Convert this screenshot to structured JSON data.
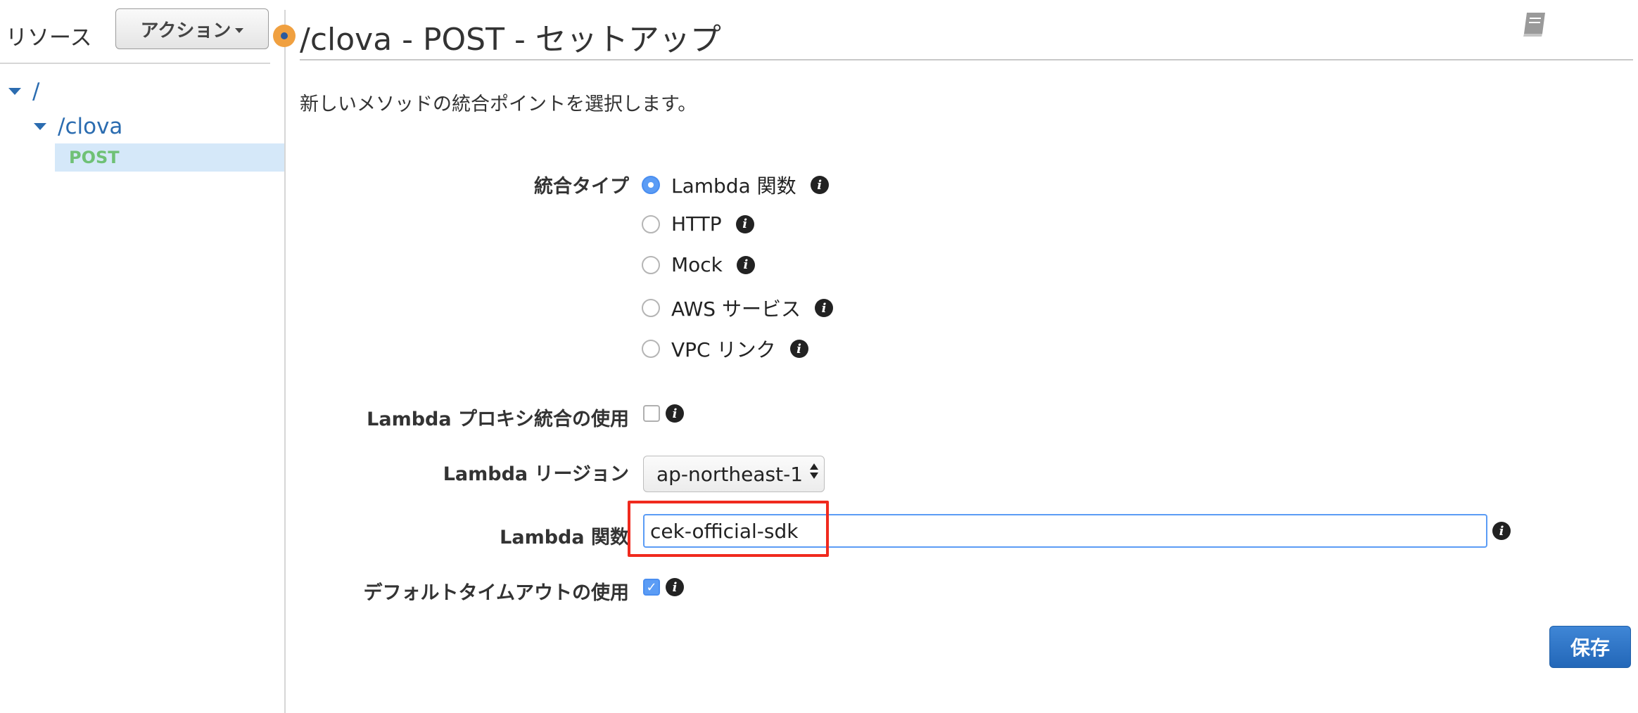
{
  "sidebar": {
    "title": "リソース",
    "actions_label": "アクション",
    "tree": {
      "root": "/",
      "clova": "/clova",
      "post": "POST"
    }
  },
  "header": {
    "title": "/clova - POST - セットアップ",
    "subtitle": "新しいメソッドの統合ポイントを選択します。"
  },
  "form": {
    "integration_type_label": "統合タイプ",
    "integration_options": [
      {
        "label": "Lambda 関数",
        "selected": true
      },
      {
        "label": "HTTP",
        "selected": false
      },
      {
        "label": "Mock",
        "selected": false
      },
      {
        "label": "AWS サービス",
        "selected": false
      },
      {
        "label": "VPC リンク",
        "selected": false
      }
    ],
    "proxy_label": "Lambda プロキシ統合の使用",
    "proxy_checked": false,
    "region_label": "Lambda リージョン",
    "region_value": "ap-northeast-1",
    "function_label": "Lambda 関数",
    "function_value": "cek-official-sdk",
    "default_timeout_label": "デフォルトタイムアウトの使用",
    "default_timeout_checked": true,
    "save_label": "保存"
  },
  "icons": {
    "info": "info-icon",
    "book": "book-icon",
    "status": "status-dot-icon",
    "check": "checkmark-icon"
  },
  "colors": {
    "accent": "#5b9cf5",
    "tree_link": "#2b6cb0",
    "post_method": "#6fc176",
    "status_dot": "#f0a040",
    "highlight": "#f02a1e",
    "save_button": "#2367b8"
  }
}
